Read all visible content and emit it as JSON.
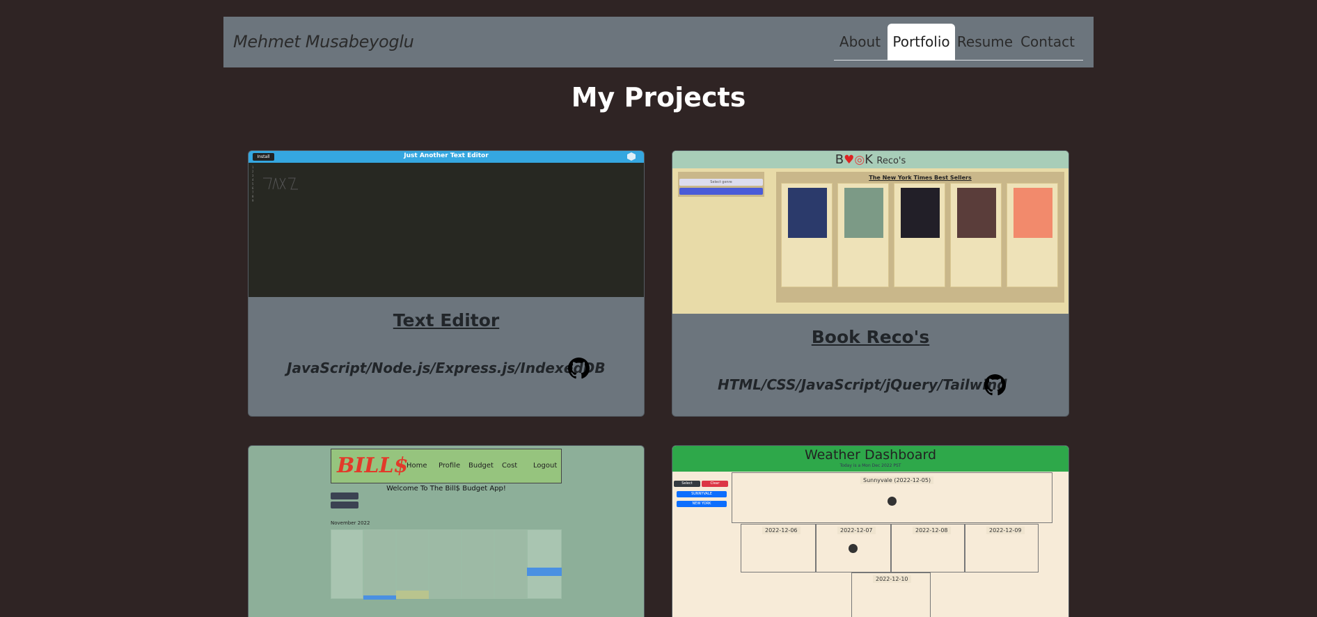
{
  "navbar": {
    "brand": "Mehmet Musabeyoglu",
    "items": [
      {
        "label": "About"
      },
      {
        "label": "Portfolio",
        "active": true
      },
      {
        "label": "Resume"
      },
      {
        "label": "Contact"
      }
    ]
  },
  "page_title": "My Projects",
  "projects": [
    {
      "title": "Text Editor",
      "tech": "JavaScript/Node.js/Express.js/IndexedDB",
      "thumb": {
        "header": "Just Another Text Editor",
        "install": "Install"
      }
    },
    {
      "title": "Book Reco's",
      "tech": "HTML/CSS/JavaScript/jQuery/Tailwind",
      "thumb": {
        "brand": "Reco's",
        "section": "The New York Times Best Sellers",
        "select": "Select genre"
      }
    },
    {
      "thumb": {
        "logo": "BILL$",
        "links": [
          "Home",
          "Profile",
          "Budget",
          "Cost",
          "Logout"
        ],
        "welcome": "Welcome To The Bill$ Budget App!",
        "month": "November 2022"
      }
    },
    {
      "thumb": {
        "header": "Weather Dashboard",
        "subheader": "Today is a Mon Dec 2022 PST  ",
        "city": "Sunnyvale (2022-12-05)",
        "days": [
          "2022-12-06",
          "2022-12-07",
          "2022-12-08",
          "2022-12-09",
          "2022-12-10"
        ],
        "buttons": [
          "Select",
          "Clear",
          "SUNNYVALE",
          "NEW YORK"
        ]
      }
    }
  ],
  "colors": {
    "background": "#2f2424",
    "navbar": "#6c757d",
    "card": "#6c757d",
    "accent": "#35a7e0"
  }
}
